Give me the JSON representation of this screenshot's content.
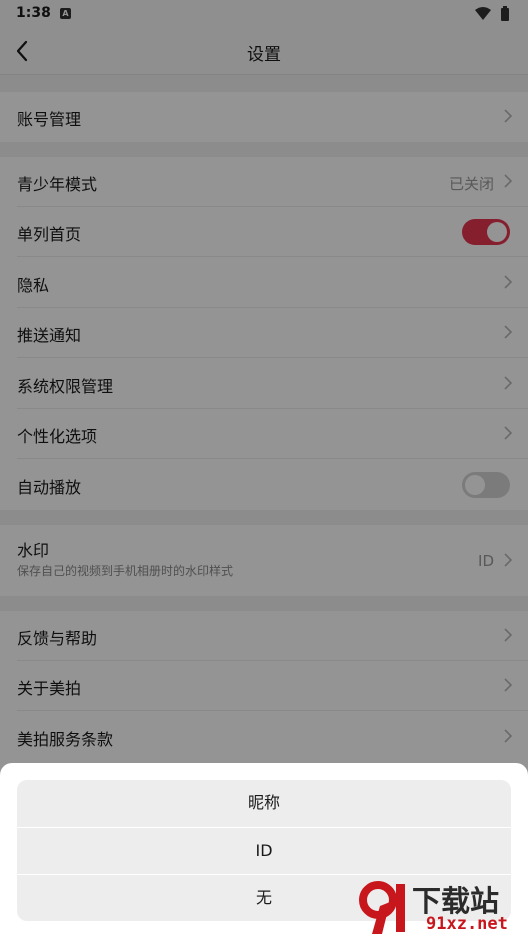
{
  "status": {
    "time": "1:38",
    "notice_letter": "A"
  },
  "header": {
    "title": "设置"
  },
  "sections": [
    {
      "rows": [
        {
          "label": "账号管理"
        }
      ]
    },
    {
      "rows": [
        {
          "label": "青少年模式",
          "value": "已关闭"
        },
        {
          "label": "单列首页",
          "toggle": true
        },
        {
          "label": "隐私"
        },
        {
          "label": "推送通知"
        },
        {
          "label": "系统权限管理"
        },
        {
          "label": "个性化选项"
        },
        {
          "label": "自动播放",
          "toggle": false
        }
      ]
    },
    {
      "rows": [
        {
          "label": "水印",
          "subtitle": "保存自己的视频到手机相册时的水印样式",
          "value": "ID"
        }
      ]
    },
    {
      "rows": [
        {
          "label": "反馈与帮助"
        },
        {
          "label": "关于美拍"
        },
        {
          "label": "美拍服务条款"
        }
      ]
    }
  ],
  "sheet": {
    "options": [
      "昵称",
      "ID",
      "无"
    ]
  },
  "watermark": {
    "logo": "下载站",
    "url": "91xz.net"
  },
  "colors": {
    "accent": "#e6344f",
    "toggle_off": "#d4d4d4",
    "background": "#f2f2f2"
  }
}
